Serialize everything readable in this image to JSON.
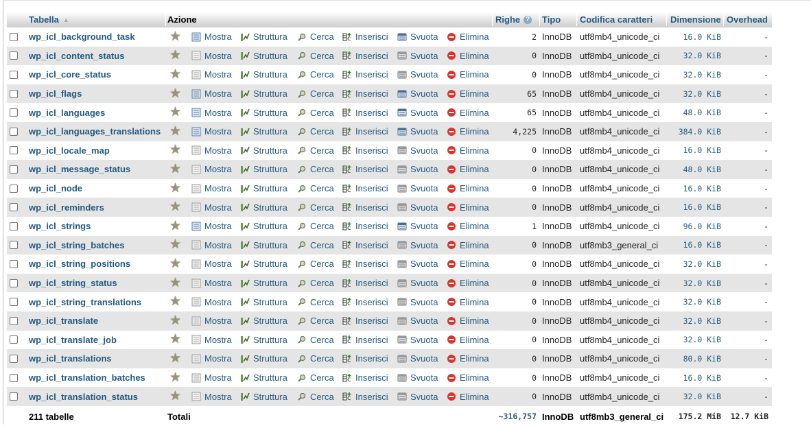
{
  "header": {
    "tabella": "Tabella",
    "azione": "Azione",
    "righe": "Righe",
    "tipo": "Tipo",
    "codifica": "Codifica caratteri",
    "dimensione": "Dimensione",
    "overhead": "Overhead"
  },
  "actions": {
    "mostra": "Mostra",
    "struttura": "Struttura",
    "cerca": "Cerca",
    "inserisci": "Inserisci",
    "svuota": "Svuota",
    "elimina": "Elimina"
  },
  "rows": [
    {
      "name": "wp_icl_background_task",
      "rows": "2",
      "type": "InnoDB",
      "collation": "utf8mb4_unicode_ci",
      "size": "16.0 KiB",
      "overhead": "-",
      "empty": false
    },
    {
      "name": "wp_icl_content_status",
      "rows": "0",
      "type": "InnoDB",
      "collation": "utf8mb4_unicode_ci",
      "size": "32.0 KiB",
      "overhead": "-",
      "empty": true
    },
    {
      "name": "wp_icl_core_status",
      "rows": "0",
      "type": "InnoDB",
      "collation": "utf8mb4_unicode_ci",
      "size": "32.0 KiB",
      "overhead": "-",
      "empty": true
    },
    {
      "name": "wp_icl_flags",
      "rows": "65",
      "type": "InnoDB",
      "collation": "utf8mb4_unicode_ci",
      "size": "32.0 KiB",
      "overhead": "-",
      "empty": false
    },
    {
      "name": "wp_icl_languages",
      "rows": "65",
      "type": "InnoDB",
      "collation": "utf8mb4_unicode_ci",
      "size": "48.0 KiB",
      "overhead": "-",
      "empty": false
    },
    {
      "name": "wp_icl_languages_translations",
      "rows": "4,225",
      "type": "InnoDB",
      "collation": "utf8mb4_unicode_ci",
      "size": "384.0 KiB",
      "overhead": "-",
      "empty": false
    },
    {
      "name": "wp_icl_locale_map",
      "rows": "0",
      "type": "InnoDB",
      "collation": "utf8mb4_unicode_ci",
      "size": "16.0 KiB",
      "overhead": "-",
      "empty": true
    },
    {
      "name": "wp_icl_message_status",
      "rows": "0",
      "type": "InnoDB",
      "collation": "utf8mb4_unicode_ci",
      "size": "48.0 KiB",
      "overhead": "-",
      "empty": true
    },
    {
      "name": "wp_icl_node",
      "rows": "0",
      "type": "InnoDB",
      "collation": "utf8mb4_unicode_ci",
      "size": "16.0 KiB",
      "overhead": "-",
      "empty": true
    },
    {
      "name": "wp_icl_reminders",
      "rows": "0",
      "type": "InnoDB",
      "collation": "utf8mb4_unicode_ci",
      "size": "16.0 KiB",
      "overhead": "-",
      "empty": true
    },
    {
      "name": "wp_icl_strings",
      "rows": "1",
      "type": "InnoDB",
      "collation": "utf8mb4_unicode_ci",
      "size": "96.0 KiB",
      "overhead": "-",
      "empty": false
    },
    {
      "name": "wp_icl_string_batches",
      "rows": "0",
      "type": "InnoDB",
      "collation": "utf8mb3_general_ci",
      "size": "16.0 KiB",
      "overhead": "-",
      "empty": true
    },
    {
      "name": "wp_icl_string_positions",
      "rows": "0",
      "type": "InnoDB",
      "collation": "utf8mb4_unicode_ci",
      "size": "32.0 KiB",
      "overhead": "-",
      "empty": true
    },
    {
      "name": "wp_icl_string_status",
      "rows": "0",
      "type": "InnoDB",
      "collation": "utf8mb4_unicode_ci",
      "size": "32.0 KiB",
      "overhead": "-",
      "empty": true
    },
    {
      "name": "wp_icl_string_translations",
      "rows": "0",
      "type": "InnoDB",
      "collation": "utf8mb4_unicode_ci",
      "size": "32.0 KiB",
      "overhead": "-",
      "empty": true
    },
    {
      "name": "wp_icl_translate",
      "rows": "0",
      "type": "InnoDB",
      "collation": "utf8mb4_unicode_ci",
      "size": "32.0 KiB",
      "overhead": "-",
      "empty": true
    },
    {
      "name": "wp_icl_translate_job",
      "rows": "0",
      "type": "InnoDB",
      "collation": "utf8mb4_unicode_ci",
      "size": "32.0 KiB",
      "overhead": "-",
      "empty": true
    },
    {
      "name": "wp_icl_translations",
      "rows": "0",
      "type": "InnoDB",
      "collation": "utf8mb4_unicode_ci",
      "size": "80.0 KiB",
      "overhead": "-",
      "empty": true
    },
    {
      "name": "wp_icl_translation_batches",
      "rows": "0",
      "type": "InnoDB",
      "collation": "utf8mb4_unicode_ci",
      "size": "16.0 KiB",
      "overhead": "-",
      "empty": true
    },
    {
      "name": "wp_icl_translation_status",
      "rows": "0",
      "type": "InnoDB",
      "collation": "utf8mb4_unicode_ci",
      "size": "32.0 KiB",
      "overhead": "-",
      "empty": true
    }
  ],
  "footer": {
    "count": "211 tabelle",
    "totali": "Totali",
    "rows": "~316,757",
    "type": "InnoDB",
    "collation": "utf8mb3_general_ci",
    "size": "175.2 MiB",
    "overhead": "12.7 KiB"
  },
  "colors": {
    "link": "#235a81",
    "row_alt": "#e5e5e5",
    "delete": "#d9342b"
  }
}
